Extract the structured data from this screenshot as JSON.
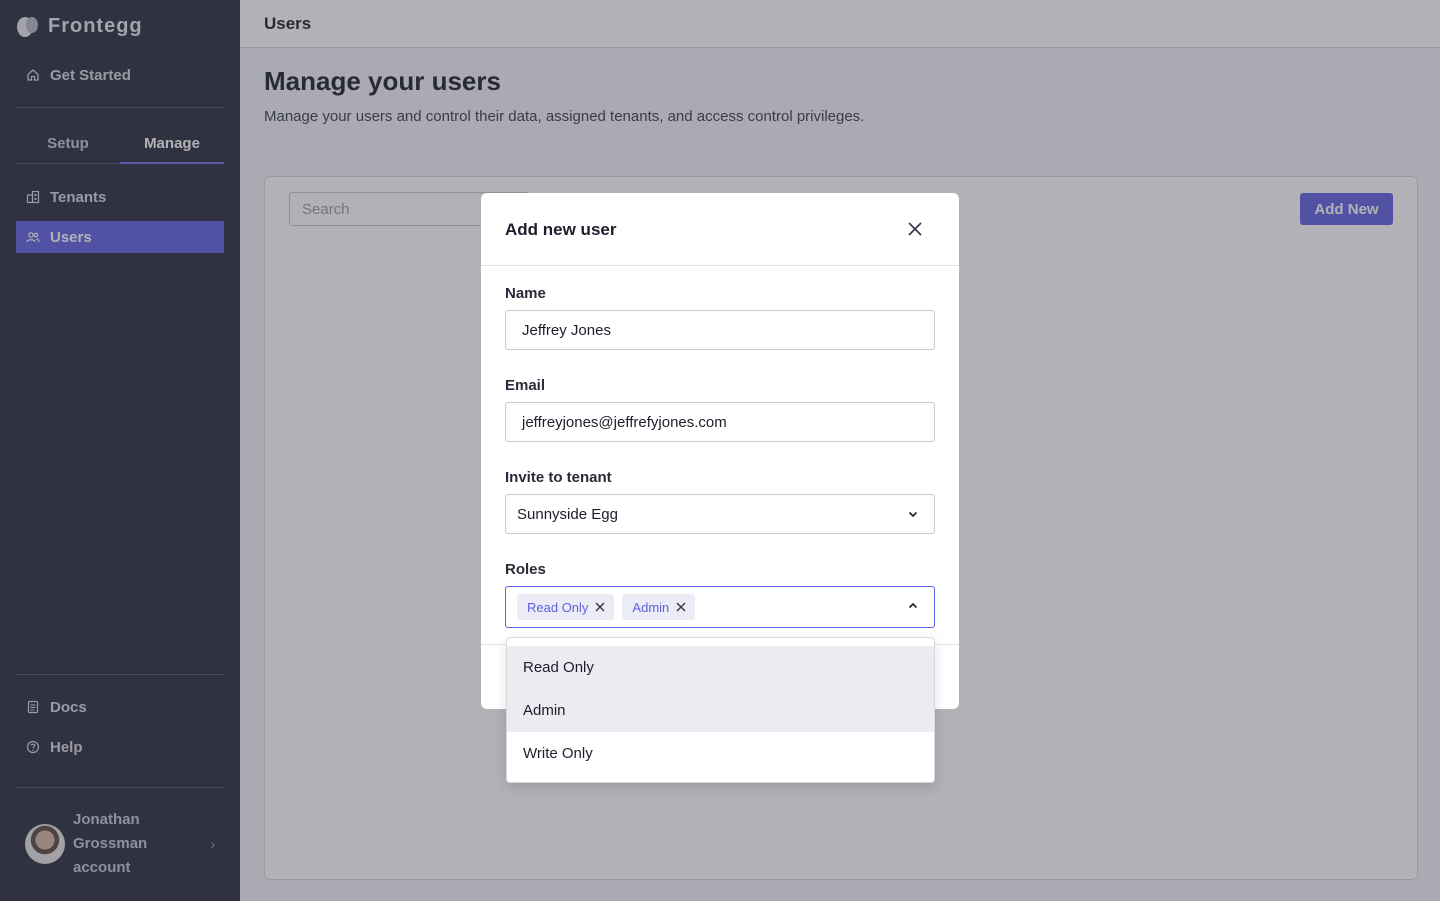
{
  "sidebar": {
    "brand": "Frontegg",
    "get_started": "Get Started",
    "tabs": [
      "Setup",
      "Manage"
    ],
    "active_tab": "Manage",
    "items": [
      {
        "label": "Tenants",
        "icon": "building-icon"
      },
      {
        "label": "Users",
        "icon": "users-icon",
        "active": true
      }
    ],
    "footer_items": [
      {
        "label": "Docs",
        "icon": "document-icon"
      },
      {
        "label": "Help",
        "icon": "help-circle-icon"
      }
    ],
    "profile": {
      "name_line1": "Jonathan",
      "name_line2": "Grossman",
      "name_line3": "account"
    }
  },
  "topbar": {
    "title": "Users"
  },
  "page": {
    "title": "Manage your users",
    "subtitle": "Manage your users and control their data, assigned tenants, and access control privileges."
  },
  "toolbar": {
    "search_placeholder": "Search",
    "add_new_label": "Add New"
  },
  "modal": {
    "title": "Add new user",
    "name_label": "Name",
    "name_value": "Jeffrey Jones",
    "email_label": "Email",
    "email_value": "jeffreyjones@jeffrefyjones.com",
    "tenant_label": "Invite to tenant",
    "tenant_value": "Sunnyside Egg",
    "roles_label": "Roles",
    "roles_selected": [
      "Read Only",
      "Admin"
    ],
    "roles_options": [
      {
        "label": "Read Only",
        "selected": true
      },
      {
        "label": "Admin",
        "selected": true
      },
      {
        "label": "Write Only",
        "selected": false
      }
    ]
  },
  "colors": {
    "accent": "#5f62e2",
    "sidebar_bg": "#2a2c3c"
  }
}
